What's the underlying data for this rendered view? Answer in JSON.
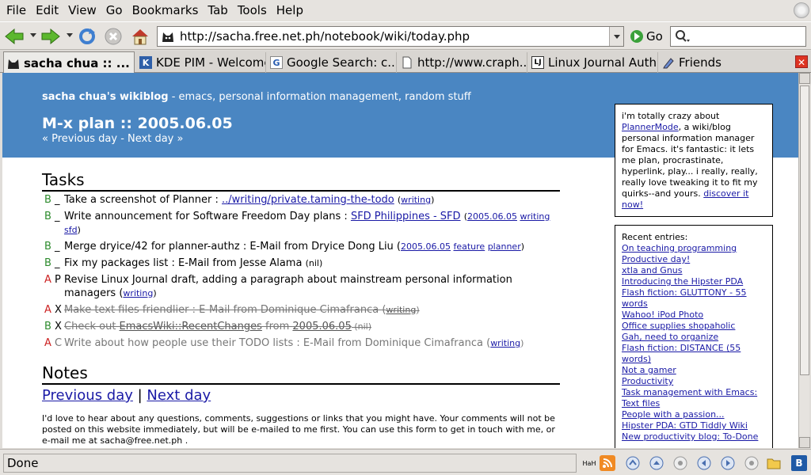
{
  "menu": [
    "File",
    "Edit",
    "View",
    "Go",
    "Bookmarks",
    "Tab",
    "Tools",
    "Help"
  ],
  "menu_accel": [
    "F",
    "E",
    "V",
    "G",
    "B",
    "T",
    "T",
    "H"
  ],
  "toolbar": {
    "url": "http://sacha.free.net.ph/notebook/wiki/today.php",
    "go_label": "Go",
    "search_placeholder": ""
  },
  "tabs": [
    {
      "label": "sacha chua :: ...",
      "icon": "cat-favicon-icon",
      "active": true
    },
    {
      "label": "KDE PIM - Welcome",
      "icon": "kde-favicon-icon"
    },
    {
      "label": "Google Search: c...",
      "icon": "google-favicon-icon"
    },
    {
      "label": "http://www.craph...",
      "icon": "page-favicon-icon"
    },
    {
      "label": "Linux Journal Auth...",
      "icon": "lj-favicon-icon"
    },
    {
      "label": "Friends",
      "icon": "pencil-favicon-icon"
    }
  ],
  "page": {
    "site_name": "sacha chua's wikiblog",
    "site_tagline": " - emacs, personal information management, random stuff",
    "title": "M-x plan :: 2005.06.05",
    "nav_prev": "« Previous day",
    "nav_sep": " - ",
    "nav_next": "Next day »",
    "tasks_heading": "Tasks",
    "notes_heading": "Notes",
    "big_prev": "Previous day",
    "big_sep": " | ",
    "big_next": "Next day",
    "paragraph": "I'd love to hear about any questions, comments, suggestions or links that you might have. Your comments will not be posted on this website immediately, but will be e-mailed to me first. You can use this form to get in touch with me, or e-mail me at sacha@free.net.ph ."
  },
  "tasks": [
    {
      "pri": "B",
      "status": "_",
      "text": "Take a screenshot of Planner : ",
      "link": "../writing/private.taming-the-todo",
      "tags": "(",
      "tag_links": [
        "writing"
      ],
      "tail": ")"
    },
    {
      "pri": "B",
      "status": "_",
      "text": "Write announcement for Software Freedom Day plans : ",
      "link": "SFD Philippines - SFD",
      "tags": " (",
      "tag_links": [
        "2005.06.05",
        "writing",
        "sfd"
      ],
      "tail": ")"
    },
    {
      "pri": "B",
      "status": "_",
      "text": "Merge dryice/42 for planner-authz : E-Mail from Dryice Dong Liu (",
      "link": "",
      "tag_links": [
        "2005.06.05",
        "feature",
        "planner"
      ],
      "tail": ")"
    },
    {
      "pri": "B",
      "status": "_",
      "text": "Fix my packages list : E-Mail from Jesse Alama ",
      "small": "(nil)"
    },
    {
      "pri": "A",
      "status": "P",
      "text": "Revise Linux Journal draft, adding a paragraph about mainstream personal information managers (",
      "tag_links": [
        "writing"
      ],
      "tail": ")"
    },
    {
      "pri": "A",
      "status": "X",
      "text": "Make text files friendlier : E-Mail from Dominique Cimafranca (",
      "tag_links": [
        "writing"
      ],
      "tail": ")"
    },
    {
      "pri": "B",
      "status": "X",
      "text": "Check out ",
      "link": "EmacsWiki::RecentChanges",
      "mid": " from ",
      "link2": "2005.06.05",
      "small": " (nil)"
    },
    {
      "pri": "A",
      "status": "C",
      "text": "Write about how people use their TODO lists : E-Mail from Dominique Cimafranca (",
      "tag_links": [
        "writing"
      ],
      "tail": ")"
    }
  ],
  "sidebar": {
    "intro_pre": "i'm totally crazy about ",
    "intro_link": "PlannerMode",
    "intro_post": ", a wiki/blog personal information manager for Emacs. it's fantastic: it lets me plan, procrastinate, hyperlink, play... i really, really, really love tweaking it to fit my quirks--and yours. ",
    "intro_link2": "discover it now!",
    "recent_heading": "Recent entries:",
    "recent": [
      "On teaching programming",
      "Productive day!",
      "xtla and Gnus",
      "Introducing the Hipster PDA",
      "Flash fiction: GLUTTONY - 55 words",
      "Wahoo! iPod Photo",
      "Office supplies shopaholic",
      "Gah, need to organize",
      "Flash fiction: DISTANCE (55 words)",
      "Not a gamer",
      "Productivity",
      "Task management with Emacs: Text files",
      "People with a passion...",
      "Hipster PDA: GTD Tiddly Wiki",
      "New productivity blog: To-Done"
    ]
  },
  "status": {
    "text": "Done",
    "indicator": "HaH"
  },
  "colors": {
    "header_bg": "#4a86c2",
    "priority_a": "#cc2222",
    "priority_b": "#2e8b2e",
    "link": "#1a1aa6"
  }
}
